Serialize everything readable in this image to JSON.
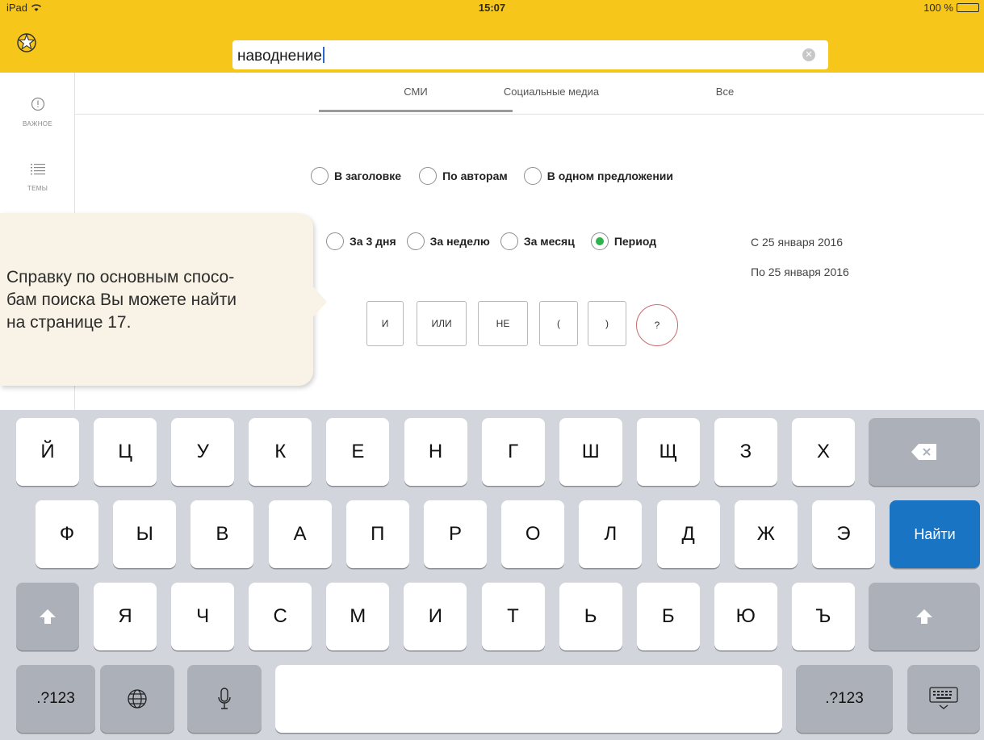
{
  "status_bar": {
    "device": "iPad",
    "time": "15:07",
    "battery_text": "100 %",
    "battery_level": 1.0
  },
  "search": {
    "value": "наводнение"
  },
  "sidebar": {
    "items": [
      {
        "icon": "alert-icon",
        "label": "ВАЖНОЕ"
      },
      {
        "icon": "list-icon",
        "label": "ТЕМЫ"
      }
    ]
  },
  "tabs": [
    {
      "label": "СМИ",
      "selected": true
    },
    {
      "label": "Социальные медиа",
      "selected": false
    },
    {
      "label": "Все",
      "selected": false
    }
  ],
  "search_in": [
    {
      "label": "В заголовке",
      "checked": false
    },
    {
      "label": "По авторам",
      "checked": false
    },
    {
      "label": "В одном предложении",
      "checked": false
    }
  ],
  "period": [
    {
      "label": "За 3 дня",
      "checked": false
    },
    {
      "label": "За неделю",
      "checked": false
    },
    {
      "label": "За месяц",
      "checked": false
    },
    {
      "label": "Период",
      "checked": true
    }
  ],
  "date_from": "С 25 января 2016",
  "date_to": "По 25 января 2016",
  "operators": [
    "И",
    "ИЛИ",
    "НЕ",
    "(",
    ")"
  ],
  "help_label": "?",
  "tooltip": "Справку по основным способам поиска Вы можете найти на странице 17.",
  "tooltip_lines": [
    "Справку по основным спосо-",
    "бам поиска Вы можете найти",
    "на странице 17."
  ],
  "keyboard": {
    "row1": [
      "Й",
      "Ц",
      "У",
      "К",
      "Е",
      "Н",
      "Г",
      "Ш",
      "Щ",
      "З",
      "Х"
    ],
    "row2": [
      "Ф",
      "Ы",
      "В",
      "А",
      "П",
      "Р",
      "О",
      "Л",
      "Д",
      "Ж",
      "Э"
    ],
    "row3": [
      "Я",
      "Ч",
      "С",
      "М",
      "И",
      "Т",
      "Ь",
      "Б",
      "Ю",
      "Ъ"
    ],
    "search_key": "Найти",
    "numbers_key": ".?123"
  },
  "colors": {
    "topbar": "#f6c61a",
    "accent_blue": "#1a74c4",
    "radio_selected": "#2db34a"
  }
}
